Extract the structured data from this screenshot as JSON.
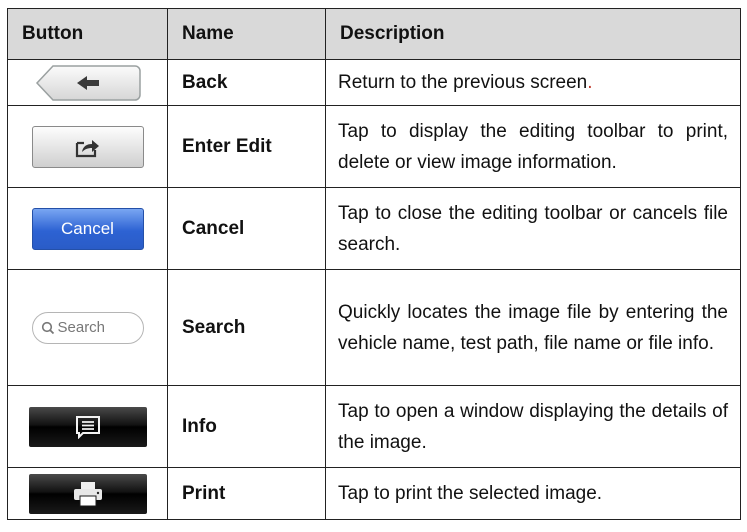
{
  "headers": {
    "button": "Button",
    "name": "Name",
    "description": "Description"
  },
  "rows": [
    {
      "icon": "back-arrow-icon",
      "name": "Back",
      "description": "Return to the previous screen",
      "description_end": "."
    },
    {
      "icon": "share-edit-icon",
      "name": "Enter Edit",
      "description": "Tap to display the editing toolbar to print, delete or view image information."
    },
    {
      "icon": "cancel-button",
      "button_text": "Cancel",
      "name": "Cancel",
      "description": "Tap to close the editing toolbar or cancels file search."
    },
    {
      "icon": "search-field-icon",
      "button_text": "Search",
      "name": "Search",
      "description": "Quickly locates the image file by entering the vehicle name, test path, file name or file info."
    },
    {
      "icon": "info-list-icon",
      "name": "Info",
      "description": "Tap to open a window displaying the details of the image."
    },
    {
      "icon": "printer-icon",
      "name": "Print",
      "description": "Tap to print the selected image."
    }
  ],
  "colors": {
    "header_bg": "#d9d9d9",
    "cancel_blue": "#2d62d3",
    "period_red": "#c0392b"
  }
}
